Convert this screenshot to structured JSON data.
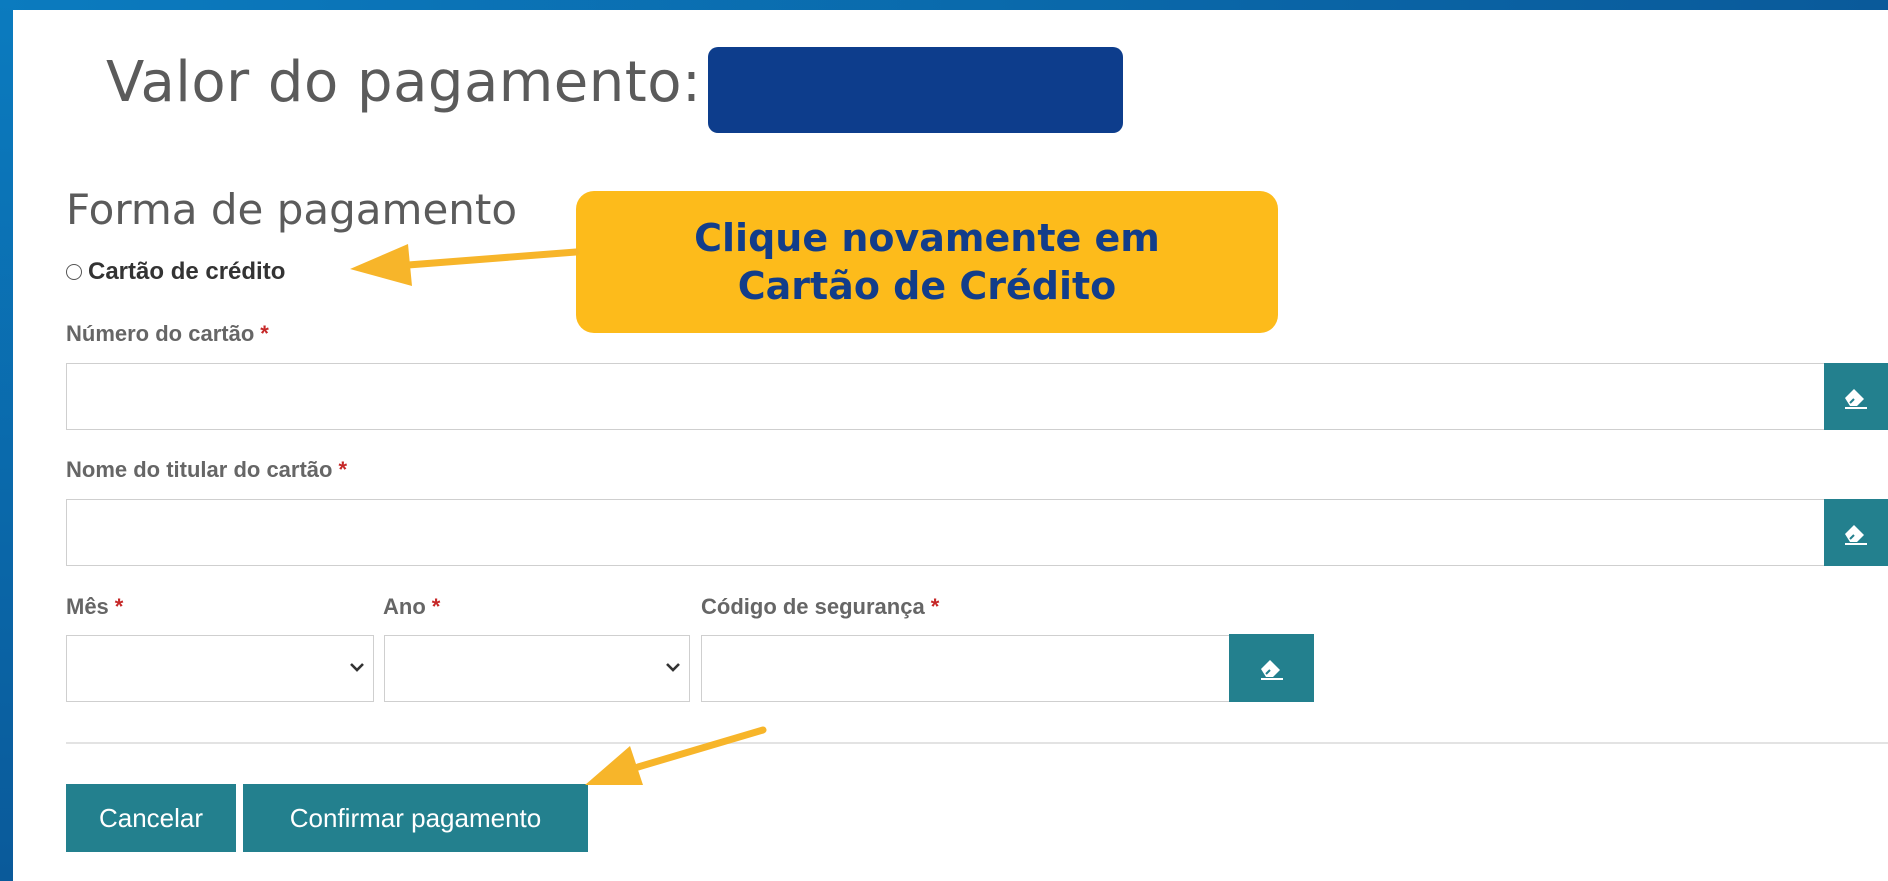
{
  "payment": {
    "title": "Valor do pagamento:"
  },
  "section": {
    "title": "Forma de pagamento",
    "radio_label": "Cartão de crédito"
  },
  "fields": {
    "card_number_label": "Número do cartão",
    "holder_name_label": "Nome do titular do cartão",
    "month_label": "Mês",
    "year_label": "Ano",
    "security_code_label": "Código de segurança",
    "required_marker": "*",
    "month_value": "",
    "year_value": ""
  },
  "actions": {
    "cancel_label": "Cancelar",
    "confirm_label": "Confirmar pagamento"
  },
  "callout": {
    "line1": "Clique novamente em",
    "line2": "Cartão de Crédito"
  },
  "colors": {
    "frame_blue": "#0a6aa8",
    "mask_navy": "#0d3d8c",
    "teal_button": "#23808e",
    "callout_yellow": "#fdbb1b",
    "callout_text": "#123d8a",
    "arrow_orange": "#f7b52a",
    "required_red": "#c62828"
  },
  "icons": {
    "field_clear": "eraser-icon",
    "select_caret": "chevron-down-icon"
  }
}
